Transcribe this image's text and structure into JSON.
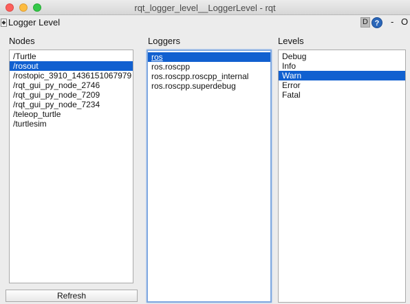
{
  "window": {
    "title": "rqt_logger_level__LoggerLevel - rqt"
  },
  "plugin": {
    "title": "Logger Level",
    "handle_glyph": "◆",
    "d_label": "D",
    "help_glyph": "?",
    "minus_label": "-",
    "close_label": "O"
  },
  "nodes": {
    "label": "Nodes",
    "items": [
      "/Turtle",
      "/rosout",
      "/rostopic_3910_1436151067979",
      "/rqt_gui_py_node_2746",
      "/rqt_gui_py_node_7209",
      "/rqt_gui_py_node_7234",
      "/teleop_turtle",
      "/turtlesim"
    ],
    "selected_index": 1
  },
  "loggers": {
    "label": "Loggers",
    "items": [
      "ros",
      "ros.roscpp",
      "ros.roscpp.roscpp_internal",
      "ros.roscpp.superdebug"
    ],
    "selected_index": 0
  },
  "levels": {
    "label": "Levels",
    "items": [
      "Debug",
      "Info",
      "Warn",
      "Error",
      "Fatal"
    ],
    "selected_index": 2
  },
  "refresh": {
    "label": "Refresh"
  },
  "colors": {
    "selection": "#1160d0",
    "focus_border": "#7fa8e0"
  }
}
